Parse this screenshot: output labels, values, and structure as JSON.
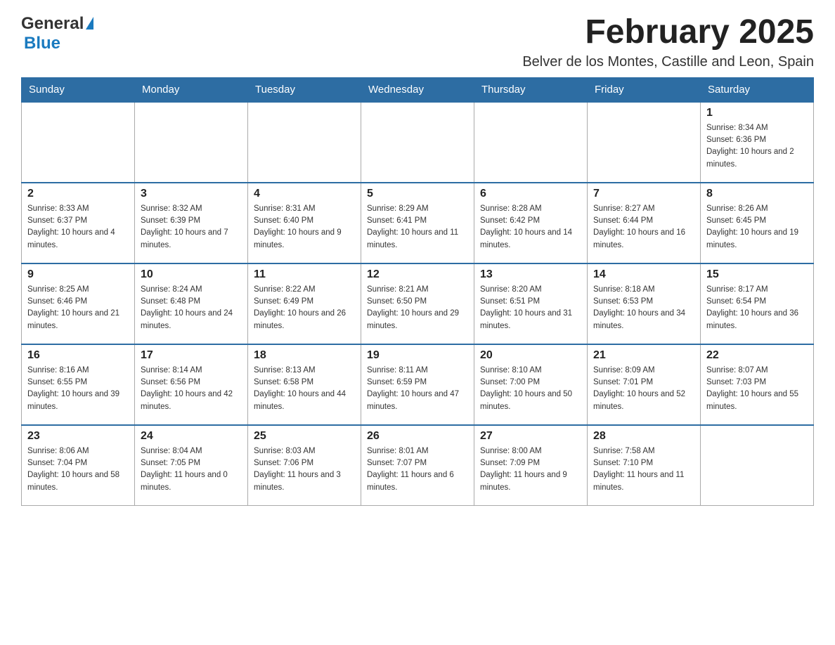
{
  "logo": {
    "general": "General",
    "blue": "Blue"
  },
  "header": {
    "month_year": "February 2025",
    "location": "Belver de los Montes, Castille and Leon, Spain"
  },
  "weekdays": [
    "Sunday",
    "Monday",
    "Tuesday",
    "Wednesday",
    "Thursday",
    "Friday",
    "Saturday"
  ],
  "weeks": [
    [
      {
        "day": "",
        "info": ""
      },
      {
        "day": "",
        "info": ""
      },
      {
        "day": "",
        "info": ""
      },
      {
        "day": "",
        "info": ""
      },
      {
        "day": "",
        "info": ""
      },
      {
        "day": "",
        "info": ""
      },
      {
        "day": "1",
        "info": "Sunrise: 8:34 AM\nSunset: 6:36 PM\nDaylight: 10 hours and 2 minutes."
      }
    ],
    [
      {
        "day": "2",
        "info": "Sunrise: 8:33 AM\nSunset: 6:37 PM\nDaylight: 10 hours and 4 minutes."
      },
      {
        "day": "3",
        "info": "Sunrise: 8:32 AM\nSunset: 6:39 PM\nDaylight: 10 hours and 7 minutes."
      },
      {
        "day": "4",
        "info": "Sunrise: 8:31 AM\nSunset: 6:40 PM\nDaylight: 10 hours and 9 minutes."
      },
      {
        "day": "5",
        "info": "Sunrise: 8:29 AM\nSunset: 6:41 PM\nDaylight: 10 hours and 11 minutes."
      },
      {
        "day": "6",
        "info": "Sunrise: 8:28 AM\nSunset: 6:42 PM\nDaylight: 10 hours and 14 minutes."
      },
      {
        "day": "7",
        "info": "Sunrise: 8:27 AM\nSunset: 6:44 PM\nDaylight: 10 hours and 16 minutes."
      },
      {
        "day": "8",
        "info": "Sunrise: 8:26 AM\nSunset: 6:45 PM\nDaylight: 10 hours and 19 minutes."
      }
    ],
    [
      {
        "day": "9",
        "info": "Sunrise: 8:25 AM\nSunset: 6:46 PM\nDaylight: 10 hours and 21 minutes."
      },
      {
        "day": "10",
        "info": "Sunrise: 8:24 AM\nSunset: 6:48 PM\nDaylight: 10 hours and 24 minutes."
      },
      {
        "day": "11",
        "info": "Sunrise: 8:22 AM\nSunset: 6:49 PM\nDaylight: 10 hours and 26 minutes."
      },
      {
        "day": "12",
        "info": "Sunrise: 8:21 AM\nSunset: 6:50 PM\nDaylight: 10 hours and 29 minutes."
      },
      {
        "day": "13",
        "info": "Sunrise: 8:20 AM\nSunset: 6:51 PM\nDaylight: 10 hours and 31 minutes."
      },
      {
        "day": "14",
        "info": "Sunrise: 8:18 AM\nSunset: 6:53 PM\nDaylight: 10 hours and 34 minutes."
      },
      {
        "day": "15",
        "info": "Sunrise: 8:17 AM\nSunset: 6:54 PM\nDaylight: 10 hours and 36 minutes."
      }
    ],
    [
      {
        "day": "16",
        "info": "Sunrise: 8:16 AM\nSunset: 6:55 PM\nDaylight: 10 hours and 39 minutes."
      },
      {
        "day": "17",
        "info": "Sunrise: 8:14 AM\nSunset: 6:56 PM\nDaylight: 10 hours and 42 minutes."
      },
      {
        "day": "18",
        "info": "Sunrise: 8:13 AM\nSunset: 6:58 PM\nDaylight: 10 hours and 44 minutes."
      },
      {
        "day": "19",
        "info": "Sunrise: 8:11 AM\nSunset: 6:59 PM\nDaylight: 10 hours and 47 minutes."
      },
      {
        "day": "20",
        "info": "Sunrise: 8:10 AM\nSunset: 7:00 PM\nDaylight: 10 hours and 50 minutes."
      },
      {
        "day": "21",
        "info": "Sunrise: 8:09 AM\nSunset: 7:01 PM\nDaylight: 10 hours and 52 minutes."
      },
      {
        "day": "22",
        "info": "Sunrise: 8:07 AM\nSunset: 7:03 PM\nDaylight: 10 hours and 55 minutes."
      }
    ],
    [
      {
        "day": "23",
        "info": "Sunrise: 8:06 AM\nSunset: 7:04 PM\nDaylight: 10 hours and 58 minutes."
      },
      {
        "day": "24",
        "info": "Sunrise: 8:04 AM\nSunset: 7:05 PM\nDaylight: 11 hours and 0 minutes."
      },
      {
        "day": "25",
        "info": "Sunrise: 8:03 AM\nSunset: 7:06 PM\nDaylight: 11 hours and 3 minutes."
      },
      {
        "day": "26",
        "info": "Sunrise: 8:01 AM\nSunset: 7:07 PM\nDaylight: 11 hours and 6 minutes."
      },
      {
        "day": "27",
        "info": "Sunrise: 8:00 AM\nSunset: 7:09 PM\nDaylight: 11 hours and 9 minutes."
      },
      {
        "day": "28",
        "info": "Sunrise: 7:58 AM\nSunset: 7:10 PM\nDaylight: 11 hours and 11 minutes."
      },
      {
        "day": "",
        "info": ""
      }
    ]
  ]
}
